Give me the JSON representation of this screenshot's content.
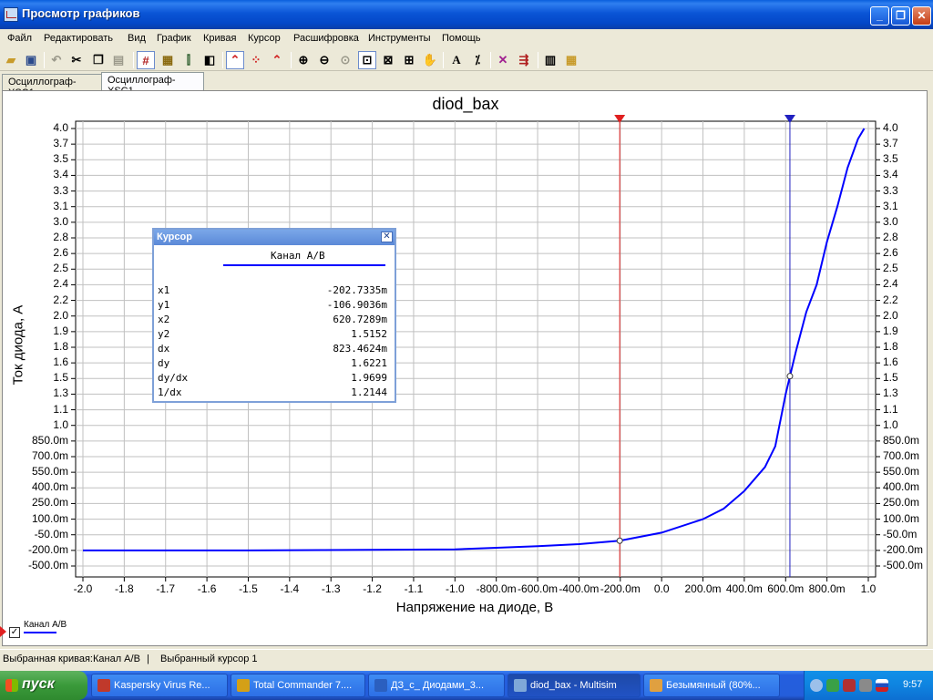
{
  "window": {
    "title": "Просмотр графиков",
    "min_glyph": "_",
    "max_glyph": "❐",
    "close_glyph": "✕"
  },
  "menu": [
    "Файл",
    "Редактировать",
    "Вид",
    "График",
    "Кривая",
    "Курсор",
    "Расшифровка",
    "Инструменты",
    "Помощь"
  ],
  "toolbar_icons": [
    "open-icon",
    "save-icon",
    "undo-icon",
    "cut-icon",
    "copy-icon",
    "paste-icon",
    "grid-icon",
    "legend-icon",
    "cursors-icon",
    "reverse-colors-icon",
    "line-style-icon",
    "dots-icon",
    "markers-icon",
    "zoom-in-icon",
    "zoom-out-icon",
    "zoom-fit-icon",
    "zoom-area-icon",
    "zoom-x-icon",
    "zoom-y-icon",
    "pan-icon",
    "text-icon",
    "properties-icon",
    "overlay-icon",
    "export-icon",
    "print-icon",
    "print-preview-icon"
  ],
  "tabs": [
    {
      "label": "Осциллограф-XSC1",
      "active": false
    },
    {
      "label": "Осциллограф-XSC1",
      "active": true
    }
  ],
  "accent_colors": {
    "curve": "#0000ff",
    "cursor1": "#e02020",
    "cursor2": "#2020c0",
    "grid": "#c0c0c0"
  },
  "chart_data": {
    "type": "line",
    "title": "diod_bax",
    "xlabel": "Напряжение на диоде, В",
    "ylabel": "Ток диода, А",
    "grid": true,
    "x_tick_labels": [
      "-2.0",
      "-1.8",
      "-1.7",
      "-1.6",
      "-1.5",
      "-1.4",
      "-1.3",
      "-1.2",
      "-1.1",
      "-1.0",
      "-800.0m",
      "-600.0m",
      "-400.0m",
      "-200.0m",
      "0.0",
      "200.0m",
      "400.0m",
      "600.0m",
      "800.0m",
      "1.0"
    ],
    "y_tick_labels": [
      "4.0",
      "3.7",
      "3.5",
      "3.4",
      "3.3",
      "3.1",
      "3.0",
      "2.8",
      "2.6",
      "2.5",
      "2.4",
      "2.2",
      "2.0",
      "1.9",
      "1.8",
      "1.6",
      "1.5",
      "1.3",
      "1.1",
      "1.0",
      "850.0m",
      "700.0m",
      "550.0m",
      "400.0m",
      "250.0m",
      "100.0m",
      "-50.0m",
      "-200.0m",
      "-500.0m"
    ],
    "ylim": [
      -0.5,
      4.0
    ],
    "xlim": [
      -2.0,
      1.0
    ],
    "series": [
      {
        "name": "Канал A/B",
        "x": [
          -2.0,
          -1.5,
          -1.0,
          -0.8,
          -0.6,
          -0.4,
          -0.2027,
          0.0,
          0.2,
          0.3,
          0.4,
          0.5,
          0.55,
          0.6,
          0.6207,
          0.65,
          0.7,
          0.75,
          0.8,
          0.85,
          0.9,
          0.95,
          0.98
        ],
        "y": [
          -0.2,
          -0.2,
          -0.19,
          -0.175,
          -0.16,
          -0.14,
          -0.107,
          -0.03,
          0.1,
          0.2,
          0.37,
          0.6,
          0.8,
          1.3,
          1.5152,
          1.75,
          2.05,
          2.4,
          2.75,
          3.1,
          3.45,
          3.8,
          4.0
        ]
      }
    ],
    "cursors": [
      {
        "name": "cursor1",
        "x": -0.2027,
        "y": -0.1069
      },
      {
        "name": "cursor2",
        "x": 0.6207,
        "y": 1.5152
      }
    ]
  },
  "cursor_panel": {
    "title": "Курсор",
    "channel": "Канал A/B",
    "rows": [
      {
        "k": "x1",
        "v": "-202.7335m"
      },
      {
        "k": "y1",
        "v": "-106.9036m"
      },
      {
        "k": "x2",
        "v": "620.7289m"
      },
      {
        "k": "y2",
        "v": "1.5152"
      },
      {
        "k": "dx",
        "v": "823.4624m"
      },
      {
        "k": "dy",
        "v": "1.6221"
      },
      {
        "k": "dy/dx",
        "v": "1.9699"
      },
      {
        "k": "1/dx",
        "v": "1.2144"
      }
    ],
    "close_glyph": "✕"
  },
  "legend": {
    "label": "Канал A/B",
    "check_glyph": "✓"
  },
  "status": {
    "selected_curve": "Выбранная кривая:Канал A/B",
    "separator": "|",
    "selected_cursor": "Выбранный курсор 1"
  },
  "taskbar": {
    "start": "пуск",
    "tasks": [
      {
        "label": "Kaspersky Virus Re...",
        "color": "#c0392b",
        "active": false
      },
      {
        "label": "Total Commander 7....",
        "color": "#d4a017",
        "active": false
      },
      {
        "label": "ДЗ_с_ Диодами_3...",
        "color": "#2b5fbf",
        "active": false
      },
      {
        "label": "diod_bax - Multisim",
        "color": "#7fa8d8",
        "active": true
      },
      {
        "label": "Безымянный (80%...",
        "color": "#e0a040",
        "active": false
      }
    ],
    "clock": "9:57"
  }
}
